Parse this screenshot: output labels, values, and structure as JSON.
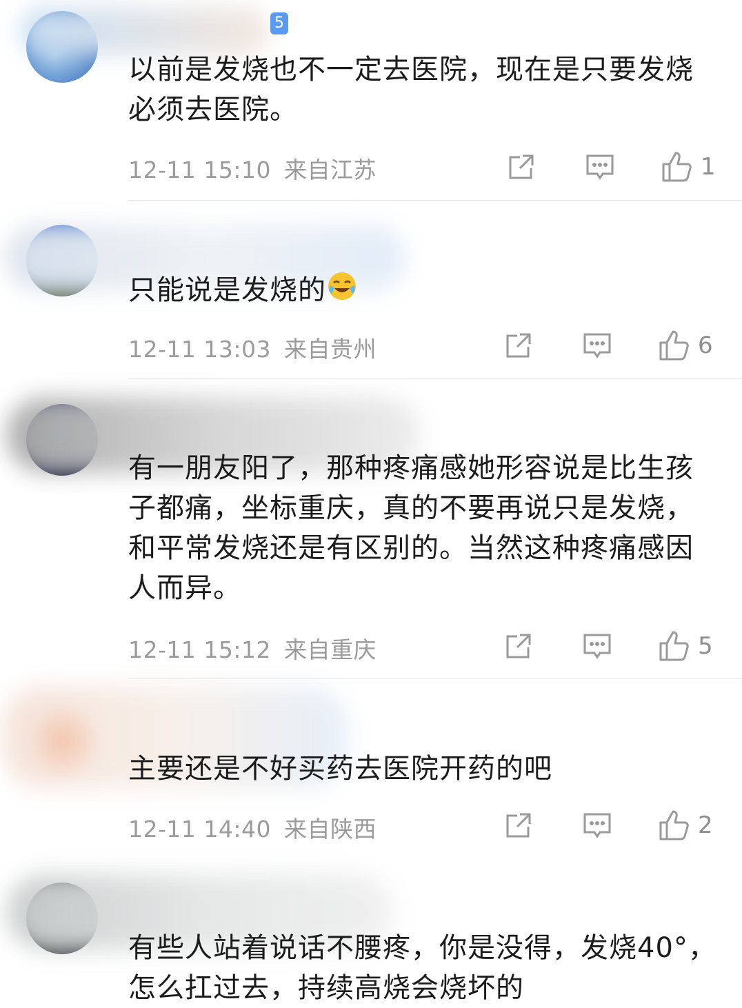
{
  "comments": [
    {
      "badge": "5",
      "text": "以前是发烧也不一定去医院，现在是只要发烧必须去医院。",
      "time": "12-11 15:10",
      "location": "来自江苏",
      "likes": "1"
    },
    {
      "text": "只能说是发烧的",
      "time": "12-11 13:03",
      "location": "来自贵州",
      "likes": "6"
    },
    {
      "text": "有一朋友阳了，那种疼痛感她形容说是比生孩子都痛，坐标重庆，真的不要再说只是发烧，和平常发烧还是有区别的。当然这种疼痛感因人而异。",
      "time": "12-11 15:12",
      "location": "来自重庆",
      "likes": "5"
    },
    {
      "text": "主要还是不好买药去医院开药的吧",
      "time": "12-11 14:40",
      "location": "来自陕西",
      "likes": "2"
    },
    {
      "text": "有些人站着说话不腰疼，你是没得，发烧40°，怎么扛过去，持续高烧会烧坏的"
    }
  ],
  "icons": {
    "share": "share-icon",
    "reply": "reply-icon",
    "like": "thumbs-up-icon",
    "emoji": "laughing-crying-emoji-icon"
  }
}
